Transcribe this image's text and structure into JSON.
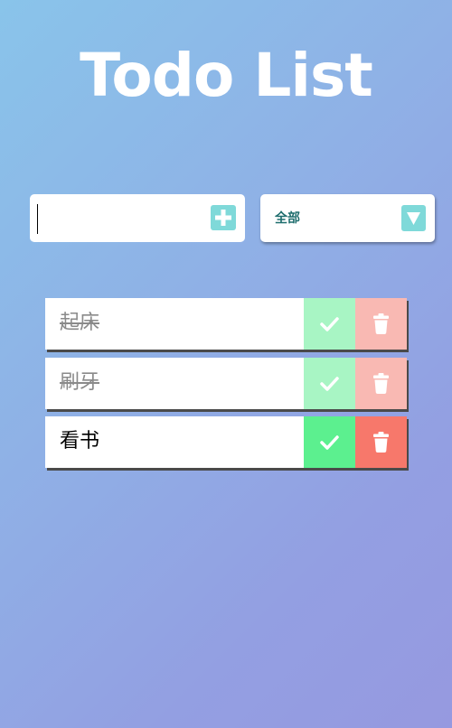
{
  "app": {
    "title": "Todo List"
  },
  "input": {
    "value": "",
    "placeholder": "",
    "add_icon": "plus-icon"
  },
  "filter": {
    "selected": "全部",
    "arrow_icon": "triangle-down-icon"
  },
  "colors": {
    "accent": "#7fd9d9",
    "complete_active": "#5cf08f",
    "complete_faded": "#a8f5c4",
    "delete_active": "#f7786b",
    "delete_faded": "#f9b9b3",
    "filter_text": "#1f6e6e"
  },
  "todos": [
    {
      "text": "起床",
      "completed": true
    },
    {
      "text": "刷牙",
      "completed": true
    },
    {
      "text": "看书",
      "completed": false
    }
  ]
}
